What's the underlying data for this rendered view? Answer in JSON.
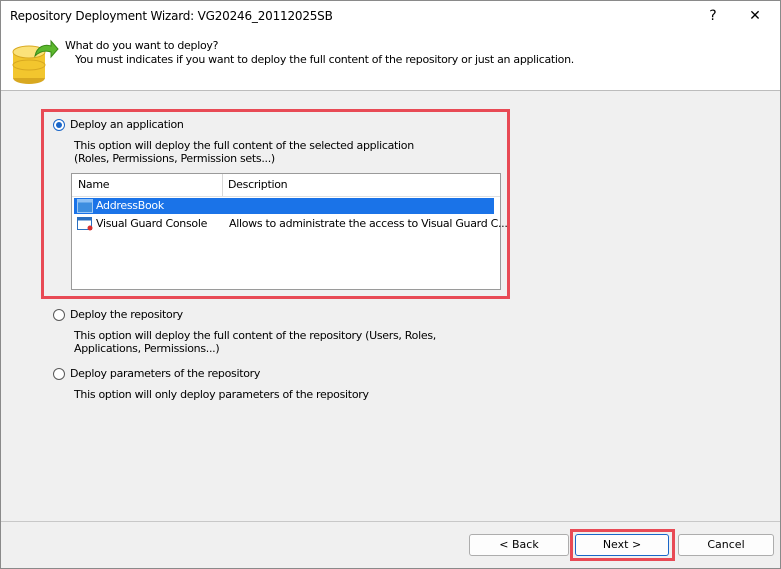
{
  "window": {
    "title": "Repository Deployment Wizard: VG20246_20112025SB",
    "help_glyph": "?",
    "close_glyph": "✕"
  },
  "header": {
    "title": "What do you want to deploy?",
    "subtitle": "You must indicates if you want to deploy the full content of the repository or just an application."
  },
  "options": {
    "application": {
      "label": "Deploy an application",
      "selected": true,
      "description_line1": "This option will deploy the full content of the selected application",
      "description_line2": "(Roles, Permissions, Permission sets...)"
    },
    "repository": {
      "label": "Deploy the repository",
      "selected": false,
      "description_line1": "This option will deploy the full content of the repository (Users, Roles,",
      "description_line2": "Applications, Permissions...)"
    },
    "parameters": {
      "label": "Deploy parameters of the repository",
      "selected": false,
      "description_line1": "This option will only deploy parameters of the repository"
    }
  },
  "app_list": {
    "columns": {
      "name": "Name",
      "description": "Description"
    },
    "rows": [
      {
        "name": "AddressBook",
        "description": "",
        "selected": true
      },
      {
        "name": "Visual Guard Console",
        "description": "Allows to administrate the access to Visual Guard C...",
        "selected": false
      }
    ]
  },
  "buttons": {
    "back": "< Back",
    "next": "Next >",
    "cancel": "Cancel"
  },
  "colors": {
    "highlight": "#e84a55",
    "selection": "#1a73e8",
    "accent": "#1a66c8"
  }
}
